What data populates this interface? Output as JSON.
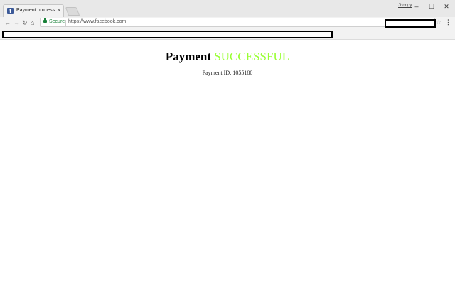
{
  "browser": {
    "tab_title": "Payment process",
    "tab_favicon_letter": "f",
    "tab_close": "×",
    "profile_name": "Jhongy",
    "window_controls": {
      "minimize": "–",
      "maximize": "☐",
      "close": "✕"
    },
    "nav": {
      "back": "←",
      "forward": "→",
      "reload": "↻",
      "home": "⌂"
    },
    "address_bar": {
      "secure_label": "Secure",
      "url": "https://www.facebook.com"
    },
    "star": "☆",
    "menu": "⋮"
  },
  "page": {
    "title_prefix": "Payment",
    "title_status": "SUCCESSFUL",
    "payment_id_label": "Payment ID:",
    "payment_id_value": "1055180"
  },
  "colors": {
    "status_green": "#99ff33",
    "secure_green": "#188038",
    "facebook_blue": "#3b5998"
  }
}
